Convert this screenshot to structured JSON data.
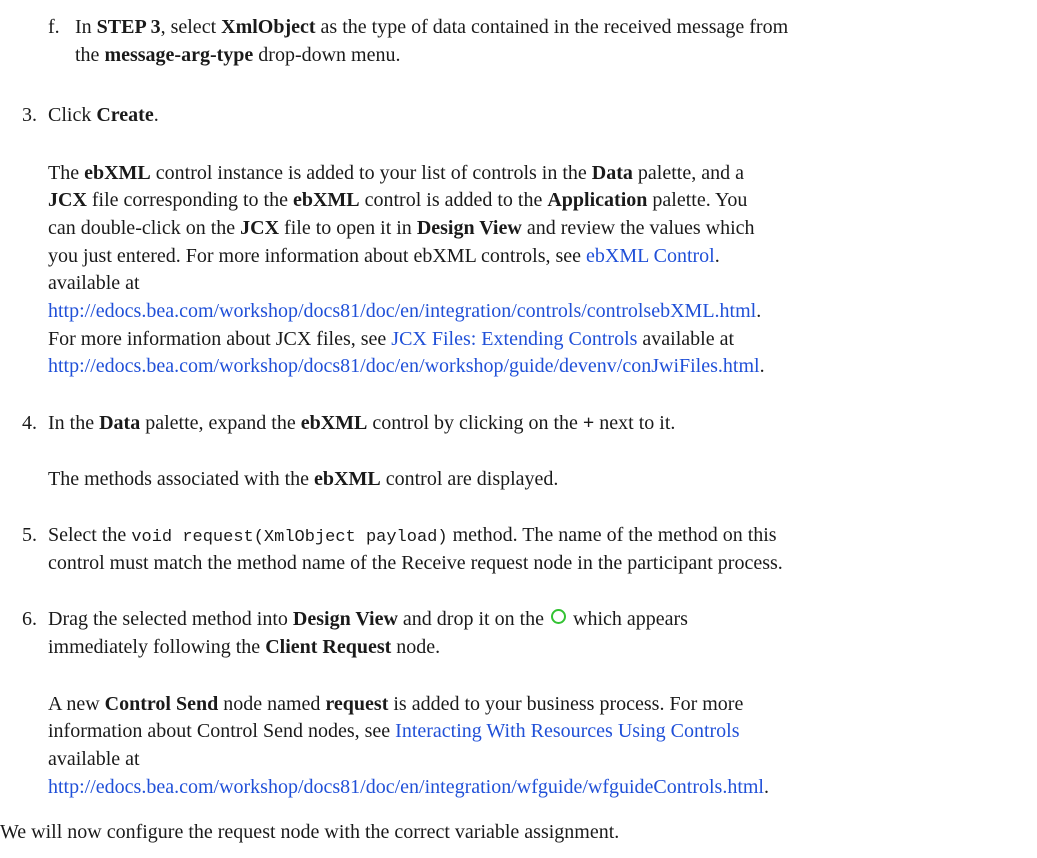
{
  "substep_f": {
    "marker": "f.",
    "t1": "In ",
    "b1": "STEP 3",
    "t2": ", select ",
    "b2": "XmlObject",
    "t3": " as the type of data contained in the received message from",
    "t4": "the ",
    "b3": "message-arg-type",
    "t5": " drop-down menu."
  },
  "step3": {
    "number": "3.",
    "t1": "Click ",
    "b1": "Create",
    "t2": ".",
    "para": {
      "l1_t1": "The ",
      "l1_b1": "ebXML",
      "l1_t2": " control instance is added to your list of controls in the ",
      "l1_b2": "Data",
      "l1_t3": " palette, and a",
      "l2_b1": "JCX",
      "l2_t1": " file corresponding to the ",
      "l2_b2": "ebXML",
      "l2_t2": " control is added to the ",
      "l2_b3": "Application",
      "l2_t3": " palette. You",
      "l3_t1": "can double-click on the ",
      "l3_b1": "JCX",
      "l3_t2": " file to open it in ",
      "l3_b2": "Design View",
      "l3_t3": " and review the values which",
      "l4_t1": "you just entered. For more information about ebXML controls, see ",
      "l4_link": "ebXML Control",
      "l4_t2": ".",
      "l5": "available at",
      "l6_link": "http://edocs.bea.com/workshop/docs81/doc/en/integration/controls/controlsebXML.html",
      "l6_t1": ".",
      "l7_t1": "For more information about JCX files, see ",
      "l7_link": "JCX Files: Extending Controls",
      "l7_t2": " available at",
      "l8_link": "http://edocs.bea.com/workshop/docs81/doc/en/workshop/guide/devenv/conJwiFiles.html",
      "l8_t1": "."
    }
  },
  "step4": {
    "number": "4.",
    "t1": "In the ",
    "b1": "Data",
    "t2": " palette, expand the ",
    "b2": "ebXML",
    "t3": " control by clicking on the ",
    "b3": "+",
    "t4": " next to it.",
    "para_t1": "The methods associated with the ",
    "para_b1": "ebXML",
    "para_t2": " control are displayed."
  },
  "step5": {
    "number": "5.",
    "t1": "Select the ",
    "code": "void request(XmlObject payload)",
    "t2": " method. The name of the method on this",
    "line2": "control must match the method name of the Receive request node in the participant process."
  },
  "step6": {
    "number": "6.",
    "t1": "Drag the selected method into ",
    "b1": "Design View",
    "t2": " and drop it on the ",
    "t3": " which appears",
    "l2_t1": "immediately following the ",
    "l2_b1": "Client Request",
    "l2_t2": " node.",
    "para": {
      "l1_t1": "A new ",
      "l1_b1": "Control Send",
      "l1_t2": " node named ",
      "l1_b2": "request",
      "l1_t3": " is added to your business process. For more",
      "l2_t1": "information about Control Send nodes, see ",
      "l2_link": "Interacting With Resources Using Controls",
      "l3": "available at",
      "l4_link": "http://edocs.bea.com/workshop/docs81/doc/en/integration/wfguide/wfguideControls.html",
      "l4_t1": "."
    }
  },
  "closing": "We will now configure the request node with the correct variable assignment.",
  "colors": {
    "link": "#2050d8",
    "circle_icon": "#33c233"
  }
}
